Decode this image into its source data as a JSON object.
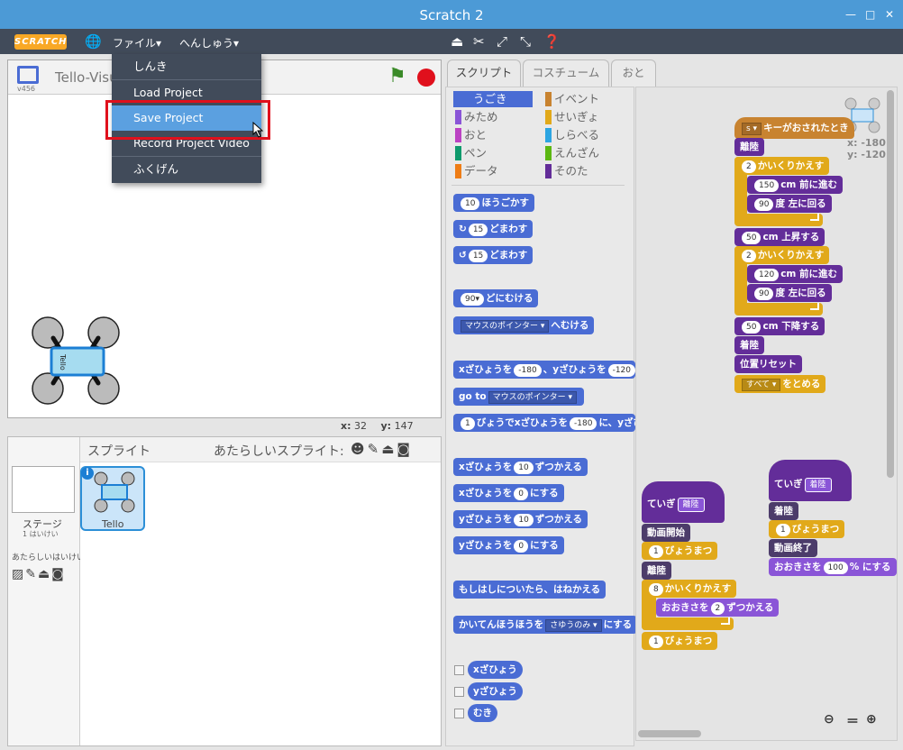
{
  "window": {
    "title": "Scratch 2"
  },
  "menubar": {
    "logo": "SCRATCH",
    "file_menu": "ファイル▾",
    "edit_menu": "へんしゅう▾"
  },
  "file_dropdown": {
    "items": [
      {
        "label": "しんき"
      },
      {
        "label": "Load Project"
      },
      {
        "label": "Save Project"
      },
      {
        "label": "Record Project Video"
      },
      {
        "label": "ふくげん"
      }
    ],
    "highlighted": "Save Project"
  },
  "stage": {
    "version": "v456",
    "title": "Tello-Visu",
    "sprite_label": "Tello",
    "coords_x_label": "x:",
    "coords_x": "32",
    "coords_y_label": "y:",
    "coords_y": "147"
  },
  "sprites": {
    "header": "スプライト",
    "new_sprite_label": "あたらしいスプライト:",
    "stage_label": "ステージ",
    "stage_backdrops": "1 はいけい",
    "new_backdrop_label": "あたらしいはいけい",
    "sprite_name": "Tello"
  },
  "tabs": [
    {
      "label": "スクリプト"
    },
    {
      "label": "コスチューム"
    },
    {
      "label": "おと"
    }
  ],
  "categories": [
    {
      "label": "うごき",
      "color": "#4a6cd4"
    },
    {
      "label": "イベント",
      "color": "#c88330"
    },
    {
      "label": "みため",
      "color": "#8a55d7"
    },
    {
      "label": "せいぎょ",
      "color": "#e1a91a"
    },
    {
      "label": "おと",
      "color": "#bb42c3"
    },
    {
      "label": "しらべる",
      "color": "#2ca5e2"
    },
    {
      "label": "ペン",
      "color": "#0e9a6c"
    },
    {
      "label": "えんざん",
      "color": "#5cb712"
    },
    {
      "label": "データ",
      "color": "#ee7d16"
    },
    {
      "label": "そのた",
      "color": "#632d99"
    }
  ],
  "palette": {
    "b_move": {
      "a": "10",
      "t": "ほうごかす"
    },
    "b_turn_r": {
      "a": "15",
      "t": "どまわす"
    },
    "b_turn_l": {
      "a": "15",
      "t": "どまわす"
    },
    "b_point_dir": {
      "a": "90▾",
      "t": "どにむける"
    },
    "b_point_towards": {
      "a": "マウスのポインター ▾",
      "t": "へむける"
    },
    "b_goto_xy": {
      "t1": "xざひょうを",
      "a": "-180",
      "t2": "、yざひょうを",
      "b": "-120"
    },
    "b_goto": {
      "t1": "go to",
      "a": "マウスのポインター ▾"
    },
    "b_glide": {
      "a": "1",
      "t1": "びょうでxざひょうを",
      "b": "-180",
      "t2": "に、yざひ"
    },
    "b_change_x": {
      "t1": "xざひょうを",
      "a": "10",
      "t2": "ずつかえる"
    },
    "b_set_x": {
      "t1": "xざひょうを",
      "a": "0",
      "t2": "にする"
    },
    "b_change_y": {
      "t1": "yざひょうを",
      "a": "10",
      "t2": "ずつかえる"
    },
    "b_set_y": {
      "t1": "yざひょうを",
      "a": "0",
      "t2": "にする"
    },
    "b_bounce": {
      "t": "もしはしについたら、はねかえる"
    },
    "b_rotation": {
      "t1": "かいてんほうほうを",
      "a": "さゆうのみ ▾",
      "t2": "にする"
    },
    "r_x": "xざひょう",
    "r_y": "yざひょう",
    "r_dir": "むき"
  },
  "scripts": {
    "sprite_x": "x: -180",
    "sprite_y": "y: -120",
    "s1": {
      "hat_key": "s ▾",
      "hat_text": "キーがおされたとき",
      "takeoff": "離陸",
      "rep1_n": "2",
      "rep_text": "かいくりかえす",
      "fwd1_n": "150",
      "fwd_text": "cm 前に進む",
      "turn1_n": "90",
      "turn_text": "度 左に回る",
      "up_n": "50",
      "up_text": "cm 上昇する",
      "rep2_n": "2",
      "fwd2_n": "120",
      "turn2_n": "90",
      "down_n": "50",
      "down_text": "cm 下降する",
      "land": "着陸",
      "reset": "位置リセット",
      "stop_dd": "すべて ▾",
      "stop_text": "をとめる"
    },
    "s2": {
      "def_text": "ていぎ",
      "def_name": "離陸",
      "vid_start": "動画開始",
      "wait1_n": "1",
      "wait_text": "びょうまつ",
      "takeoff": "離陸",
      "rep_n": "8",
      "rep_text": "かいくりかえす",
      "size_t1": "おおきさを",
      "size_n": "2",
      "size_t2": "ずつかえる",
      "wait2_n": "1"
    },
    "s3": {
      "def_text": "ていぎ",
      "def_name": "着陸",
      "land": "着陸",
      "wait_n": "1",
      "wait_text": "びょうまつ",
      "vid_end": "動画終了",
      "size_t1": "おおきさを",
      "size_n": "100",
      "size_t2": "% にする"
    }
  }
}
